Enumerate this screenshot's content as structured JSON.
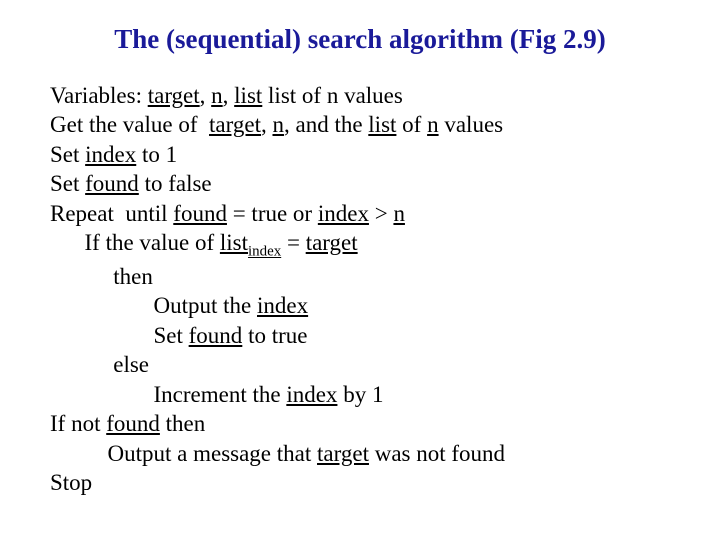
{
  "title": "The (sequential) search algorithm (Fig 2.9)",
  "vars_line": {
    "prefix": "Variables: ",
    "u1": "target",
    "c1": ", ",
    "u2": "n",
    "c2": ", ",
    "u3": "list",
    "rest": " list of n values"
  },
  "l1": {
    "p1": "Get the value of  ",
    "u1": "target",
    "c1": ", ",
    "u2": "n",
    "c2": ", and the ",
    "u3": "list",
    "c3": " of ",
    "u4": "n",
    "c4": " values"
  },
  "l2": {
    "p1": "Set ",
    "u1": "index",
    "p2": " to 1"
  },
  "l3": {
    "p1": "Set ",
    "u1": "found",
    "p2": " to false"
  },
  "l4": {
    "p1": "Repeat  until ",
    "u1": "found",
    "p2": " = true or ",
    "u2": "index",
    "p3": " > ",
    "u3": "n"
  },
  "l5": {
    "p1": "      If the value of ",
    "u1": "list",
    "sub": "index",
    "p2": " = ",
    "u2": "target"
  },
  "l6": "           then",
  "l7": {
    "p1": "                  Output the ",
    "u1": "index"
  },
  "l8": {
    "p1": "                  Set ",
    "u1": "found",
    "p2": " to true"
  },
  "l9": "           else",
  "l10": {
    "p1": "                  Increment the ",
    "u1": "index",
    "p2": " by 1"
  },
  "l11": {
    "p1": "If not ",
    "u1": "found",
    "p2": " then"
  },
  "l12": {
    "p1": "          Output a message that ",
    "u1": "target",
    "p2": " was not found"
  },
  "l13": "Stop"
}
